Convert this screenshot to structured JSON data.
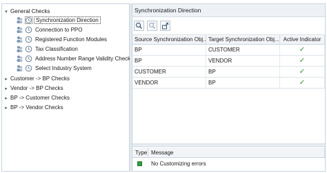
{
  "tree": {
    "items": [
      {
        "label": "General Checks",
        "expanded": true,
        "level": 0
      },
      {
        "label": "Synchronization Direction",
        "level": 1,
        "selected": true
      },
      {
        "label": "Connection to PPO",
        "level": 1
      },
      {
        "label": "Registered Function Modules",
        "level": 1
      },
      {
        "label": "Tax Classification",
        "level": 1
      },
      {
        "label": "Address Number Range Validity Check",
        "level": 1
      },
      {
        "label": "Select Industry System",
        "level": 1
      },
      {
        "label": "Customer -> BP Checks",
        "level": 0
      },
      {
        "label": "Vendor -> BP Checks",
        "level": 0
      },
      {
        "label": "BP -> Customer Checks",
        "level": 0
      },
      {
        "label": "BP -> Vendor Checks",
        "level": 0
      }
    ]
  },
  "panel": {
    "title": "Synchronization Direction"
  },
  "toolbar": {
    "buttons": [
      "details-icon",
      "find-icon",
      "export-icon"
    ]
  },
  "grid": {
    "columns": [
      "Source Synchronization Obj...",
      "Target Synchronization Obj...",
      "Active Indicator"
    ],
    "rows": [
      {
        "source": "BP",
        "target": "CUSTOMER",
        "active": "✓"
      },
      {
        "source": "BP",
        "target": "VENDOR",
        "active": "✓"
      },
      {
        "source": "CUSTOMER",
        "target": "BP",
        "active": "✓"
      },
      {
        "source": "VENDOR",
        "target": "BP",
        "active": "✓"
      }
    ]
  },
  "messages": {
    "columns": [
      "Type",
      "Message"
    ],
    "rows": [
      {
        "type_color": "#2f9d3f",
        "text": "No Customizing errors"
      }
    ]
  },
  "colors": {
    "check": "#2a8a2a",
    "success": "#2f9d3f"
  }
}
